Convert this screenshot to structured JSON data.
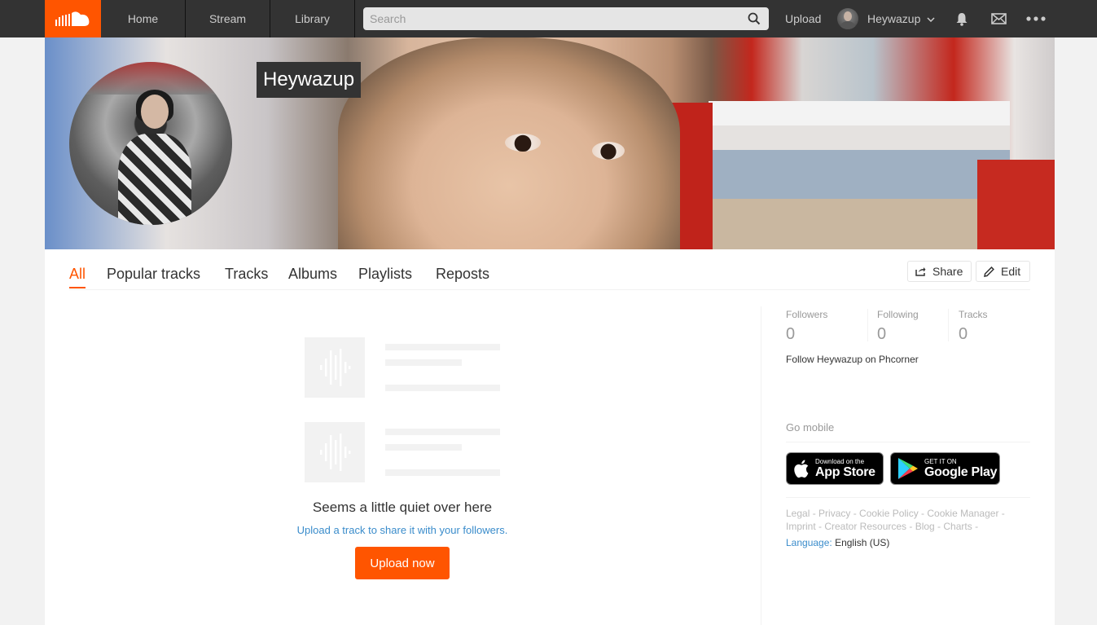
{
  "nav": {
    "home": "Home",
    "stream": "Stream",
    "library": "Library",
    "search_placeholder": "Search",
    "upload": "Upload",
    "username": "Heywazup"
  },
  "profile": {
    "name": "Heywazup"
  },
  "tabs": [
    {
      "label": "All"
    },
    {
      "label": "Popular tracks"
    },
    {
      "label": "Tracks"
    },
    {
      "label": "Albums"
    },
    {
      "label": "Playlists"
    },
    {
      "label": "Reposts"
    }
  ],
  "actions": {
    "share": "Share",
    "edit": "Edit"
  },
  "empty_state": {
    "message": "Seems a little quiet over here",
    "hint": "Upload a track to share it with your followers.",
    "button": "Upload now"
  },
  "stats": [
    {
      "label": "Followers",
      "value": "0"
    },
    {
      "label": "Following",
      "value": "0"
    },
    {
      "label": "Tracks",
      "value": "0"
    }
  ],
  "follow_text": "Follow Heywazup on Phcorner",
  "mobile": {
    "heading": "Go mobile",
    "app_store_small": "Download on the",
    "app_store_big": "App Store",
    "google_small": "GET IT ON",
    "google_big": "Google Play"
  },
  "footer": {
    "links_line1": "Legal - Privacy - Cookie Policy - Cookie Manager -",
    "links_line2": "Imprint - Creator Resources - Blog - Charts -",
    "language_label": "Language:",
    "language_value": "English (US)"
  },
  "colors": {
    "brand": "#ff5500",
    "nav_bg": "#333333",
    "link": "#3a8ccb"
  }
}
